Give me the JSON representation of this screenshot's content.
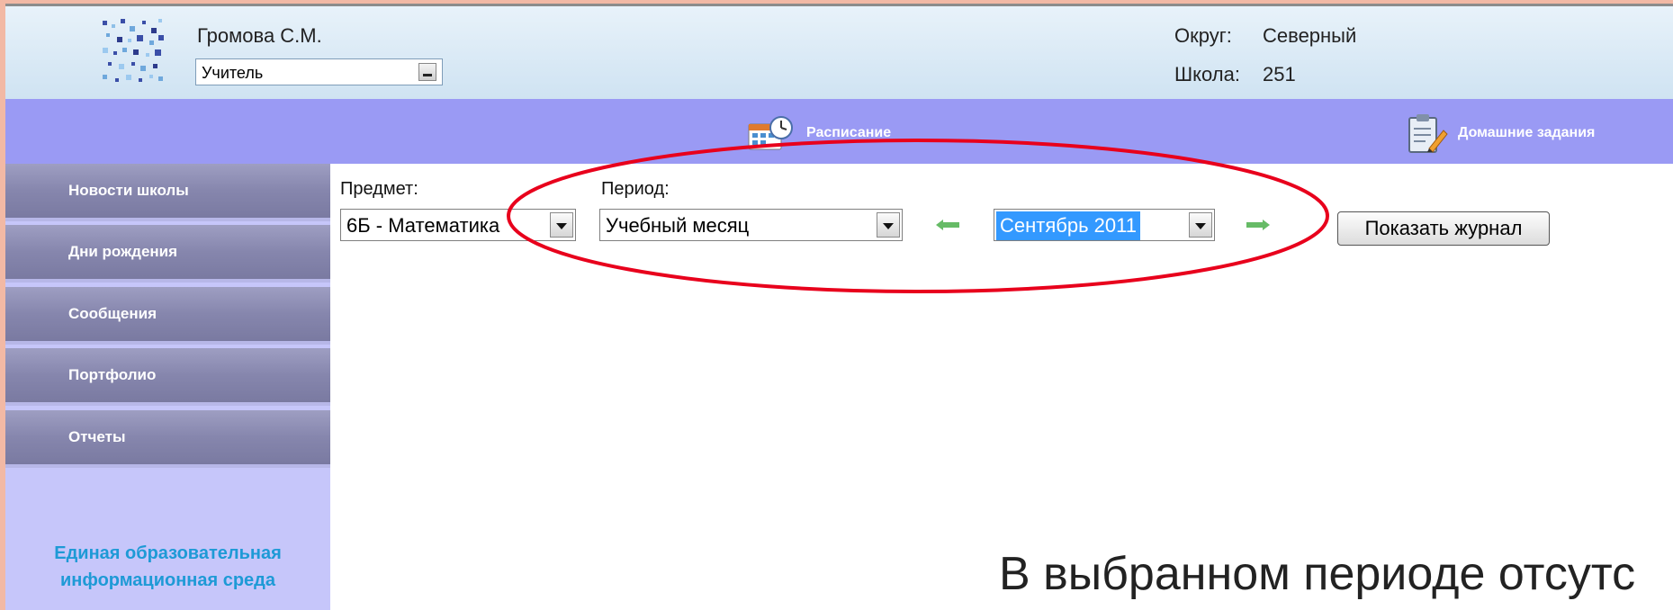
{
  "header": {
    "user_name": "Громова С.М.",
    "role_value": "Учитель",
    "district_label": "Округ:",
    "district_value": "Северный",
    "school_label": "Школа:",
    "school_value": "251"
  },
  "toolbar": {
    "schedule_label": "Расписание",
    "homework_label": "Домашние задания"
  },
  "sidebar": {
    "items": [
      {
        "label": "Новости школы"
      },
      {
        "label": "Дни рождения"
      },
      {
        "label": "Сообщения"
      },
      {
        "label": "Портфолио"
      },
      {
        "label": "Отчеты"
      }
    ],
    "brand_line1": "Единая образовательная",
    "brand_line2": "информационная среда"
  },
  "filters": {
    "subject_label": "Предмет:",
    "subject_value": "6Б - Математика",
    "period_label": "Период:",
    "period_type_value": "Учебный месяц",
    "month_value": "Сентябрь 2011",
    "show_button_label": "Показать журнал"
  },
  "main": {
    "notice_text": "В выбранном периоде отсутс"
  },
  "colors": {
    "toolbar_bg": "#9a9af4",
    "sidebar_bg": "#c6c6fa",
    "brand_text": "#1e9ad6",
    "highlight": "#e8001c",
    "nav_arrow": "#66bb66"
  },
  "icons": {
    "logo": "pixel-mosaic-logo",
    "schedule": "calendar-clock-icon",
    "homework": "clipboard-pencil-icon",
    "prev": "arrow-left-icon",
    "next": "arrow-right-icon"
  }
}
